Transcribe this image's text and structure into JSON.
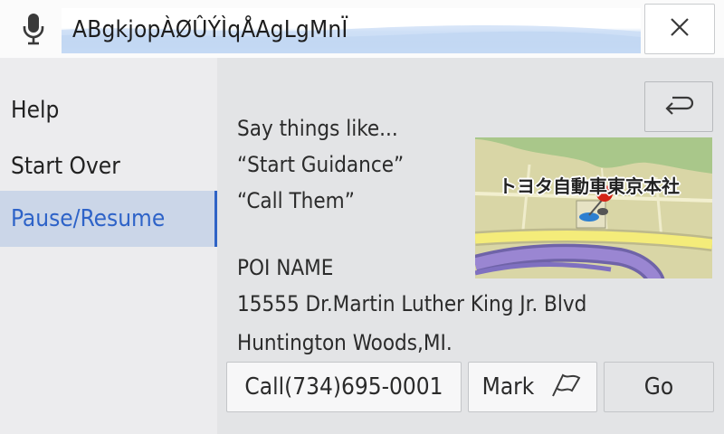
{
  "search": {
    "query_text": "ABgkjopÀØÛÝÌqÅAgLgMnÏ",
    "close_glyph": "✕"
  },
  "sidebar": {
    "items": [
      {
        "label": "Help"
      },
      {
        "label": "Start Over"
      },
      {
        "label": "Pause/Resume",
        "active": true
      }
    ]
  },
  "hints": {
    "intro": "Say things like...",
    "examples": [
      "“Start Guidance”",
      "“Call Them”"
    ]
  },
  "map": {
    "place_label": "トヨタ自動車東京本社"
  },
  "poi": {
    "name": "POI NAME",
    "address_line1": "15555 Dr.Martin Luther King Jr. Blvd",
    "address_line2": "Huntington Woods,MI."
  },
  "actions": {
    "call_label": "Call(734)695-0001",
    "mark_label": "Mark",
    "go_label": "Go"
  },
  "colors": {
    "accent": "#2e63c8",
    "active_bg": "#cbd6e8",
    "pin_red": "#d42418",
    "road_purple": "#8e7ac4"
  }
}
